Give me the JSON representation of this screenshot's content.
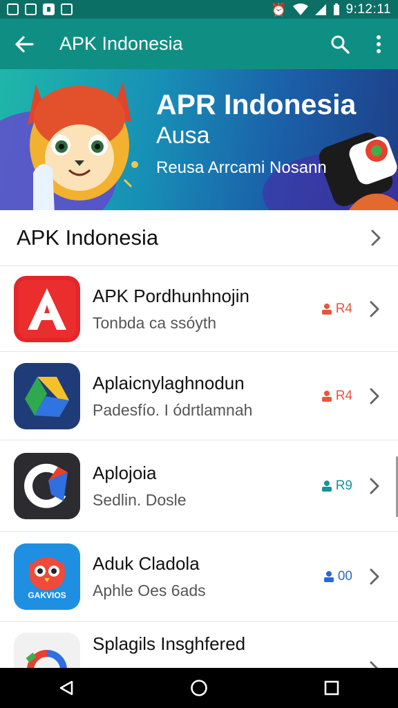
{
  "status_bar": {
    "time": "9:12:11",
    "icons": [
      "image-icon",
      "image-icon",
      "image-icon",
      "sim-icon",
      "alarm-icon",
      "wifi-icon",
      "signal-icon",
      "battery-icon"
    ]
  },
  "app_bar": {
    "title": "APK Indonesia",
    "background": "#0f8f84"
  },
  "banner": {
    "title": "APR Indonesia",
    "subtitle": "Ausa",
    "tagline": "Reusa Arrcami Nosann"
  },
  "section": {
    "title": "APK Indonesia"
  },
  "apps": [
    {
      "title": "APK Pordhunhnojin",
      "subtitle": "Tonbda ca ssóyth",
      "rating": "R4",
      "rating_color": "#e8553b",
      "icon": "red-a-icon"
    },
    {
      "title": "Aplaicnylaghnodun",
      "subtitle": "Padesfío. I ódrtlamnah",
      "rating": "R4",
      "rating_color": "#e8553b",
      "icon": "triangle-drive-icon"
    },
    {
      "title": "Aplojoia",
      "subtitle": "Sedlin. Dosle",
      "rating": "R9",
      "rating_color": "#14949a",
      "icon": "g-logo-icon"
    },
    {
      "title": "Aduk Cladola",
      "subtitle": "Aphle Oes 6ads",
      "rating": "00",
      "rating_color": "#2a66d8",
      "icon": "owl-mascot-icon",
      "icon_label": "GAKVIOS"
    },
    {
      "title": "Splagils Insghfered",
      "subtitle": "",
      "rating": "",
      "rating_color": "#888888",
      "icon": "colorful-g-icon"
    }
  ]
}
